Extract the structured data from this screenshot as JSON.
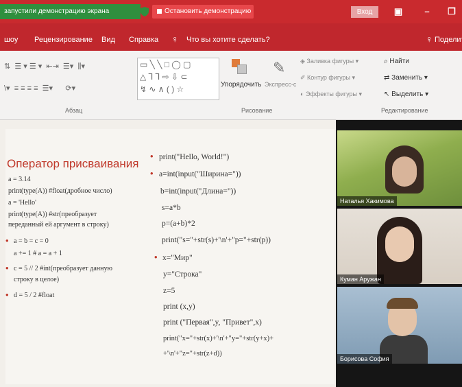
{
  "share_bar": {
    "status_text": "запустили демонстрацию экрана",
    "stop_label": "Остановить демонстрацию",
    "login_label": "Вход"
  },
  "menu": {
    "items": [
      "шоу",
      "Рецензирование",
      "Вид",
      "Справка",
      "Что вы хотите сделать?",
      "Поделиться"
    ]
  },
  "ribbon": {
    "paragraph_label": "Абзац",
    "drawing_label": "Рисование",
    "editing_label": "Редактирование",
    "arrange_label": "Упорядочить",
    "express_styles_label": "Экспресс-стили",
    "fill_label": "Заливка фигуры",
    "outline_label": "Контур фигуры",
    "effects_label": "Эффекты фигуры",
    "find_label": "Найти",
    "replace_label": "Заменить",
    "select_label": "Выделить"
  },
  "slide": {
    "title": "Оператор присваивания",
    "left_lines": [
      "a = 3.14",
      "print(type(A)) #float(дробное число)",
      "a = 'Hello'",
      "print(type(A)) #str(преобразует",
      "переданный ей аргумент в строку)",
      "a = b = c = 0",
      "a += 1   # a = a + 1",
      "c = 5 // 2  #int(преобразует данную",
      "строку в целое)",
      "d = 5 / 2   #float"
    ],
    "right_lines": [
      "print(\"Hello, World!\")",
      "a=int(input(\"Ширина=\"))",
      "b=int(input(\"Длина=\"))",
      "s=a*b",
      "p=(a+b)*2",
      "print(\"s=\"+str(s)+'\\n'+\"p=\"+str(p))",
      "x=\"Мир\"",
      "y=\"Строка\"",
      "z=5",
      "print (x,y)",
      "print (\"Первая\",y, \"Привет\",x)",
      "print(\"x=\"+str(x)+'\\n'+\"y=\"+str(y+x)+",
      "+'\\n'+\"z=\"+str(z+d))"
    ]
  },
  "participants": [
    {
      "name": "Наталья Хакимова"
    },
    {
      "name": "Куман Аружан"
    },
    {
      "name": "Борисова София"
    }
  ],
  "colors": {
    "share_bar": "#c92a2e",
    "stop_button": "#e8474b",
    "menu_bar": "#c0272d",
    "slide_title": "#c0392b"
  }
}
